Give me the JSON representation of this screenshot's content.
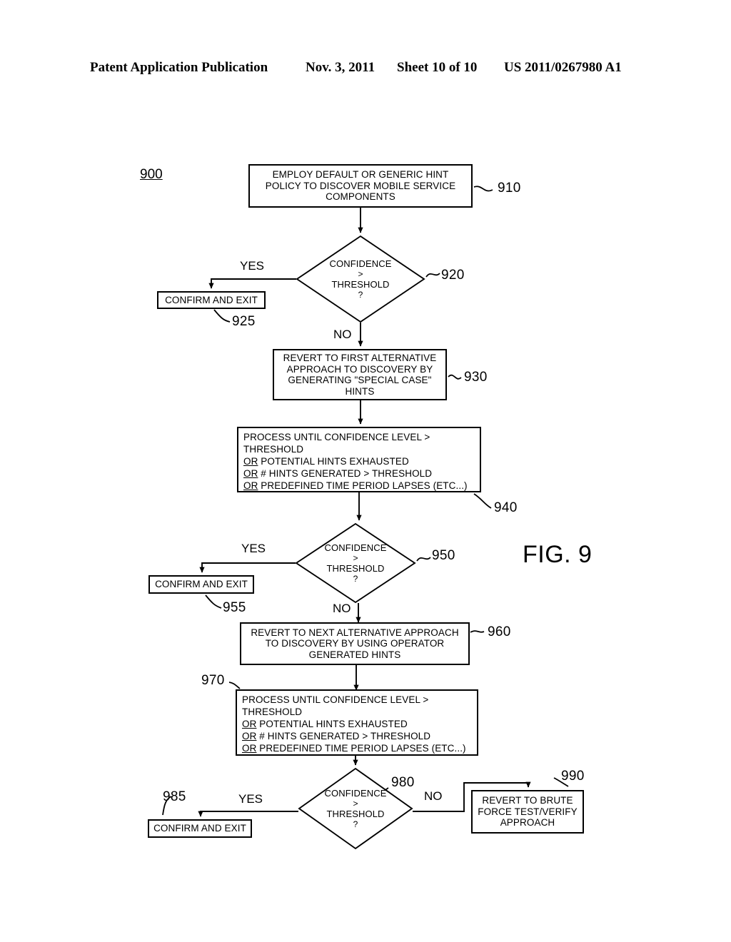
{
  "header": {
    "title": "Patent Application Publication",
    "date": "Nov. 3, 2011",
    "sheet": "Sheet 10 of 10",
    "publication_number": "US 2011/0267980 A1"
  },
  "figure": {
    "caption": "FIG. 9",
    "flow_id": "900"
  },
  "nodes": {
    "n910": {
      "ref": "910",
      "line1": "EMPLOY DEFAULT OR GENERIC HINT",
      "line2": "POLICY TO DISCOVER MOBILE SERVICE",
      "line3": "COMPONENTS"
    },
    "n920": {
      "ref": "920",
      "line1": "CONFIDENCE",
      "line2": ">",
      "line3": "THRESHOLD",
      "line4": "?"
    },
    "n925": {
      "ref": "925",
      "label": "CONFIRM AND EXIT"
    },
    "n930": {
      "ref": "930",
      "line1": "REVERT TO FIRST ALTERNATIVE",
      "line2": "APPROACH TO DISCOVERY BY",
      "line3": "GENERATING \"SPECIAL CASE\"",
      "line4": "HINTS"
    },
    "n940": {
      "ref": "940",
      "line1": "PROCESS UNTIL CONFIDENCE LEVEL >",
      "line2": "THRESHOLD",
      "line3_or": "OR",
      "line3": " POTENTIAL HINTS EXHAUSTED",
      "line4_or": "OR",
      "line4": " # HINTS GENERATED > THRESHOLD",
      "line5_or": "OR",
      "line5": " PREDEFINED TIME PERIOD LAPSES (ETC...)"
    },
    "n950": {
      "ref": "950",
      "line1": "CONFIDENCE",
      "line2": ">",
      "line3": "THRESHOLD",
      "line4": "?"
    },
    "n955": {
      "ref": "955",
      "label": "CONFIRM AND EXIT"
    },
    "n960": {
      "ref": "960",
      "line1": "REVERT TO NEXT ALTERNATIVE APPROACH",
      "line2": "TO DISCOVERY BY USING OPERATOR",
      "line3": "GENERATED HINTS"
    },
    "n970": {
      "ref": "970",
      "line1": "PROCESS UNTIL CONFIDENCE LEVEL >",
      "line2": "THRESHOLD",
      "line3_or": "OR",
      "line3": " POTENTIAL HINTS EXHAUSTED",
      "line4_or": "OR",
      "line4": " # HINTS GENERATED > THRESHOLD",
      "line5_or": "OR",
      "line5": " PREDEFINED TIME PERIOD LAPSES (ETC...)"
    },
    "n980": {
      "ref": "980",
      "line1": "CONFIDENCE",
      "line2": ">",
      "line3": "THRESHOLD",
      "line4": "?"
    },
    "n985": {
      "ref": "985",
      "label": "CONFIRM AND EXIT"
    },
    "n990": {
      "ref": "990",
      "line1": "REVERT TO BRUTE",
      "line2": "FORCE TEST/VERIFY",
      "line3": "APPROACH"
    }
  },
  "edges": {
    "yes1": "YES",
    "no1": "NO",
    "yes2": "YES",
    "no2": "NO",
    "yes3": "YES",
    "no3": "NO"
  }
}
